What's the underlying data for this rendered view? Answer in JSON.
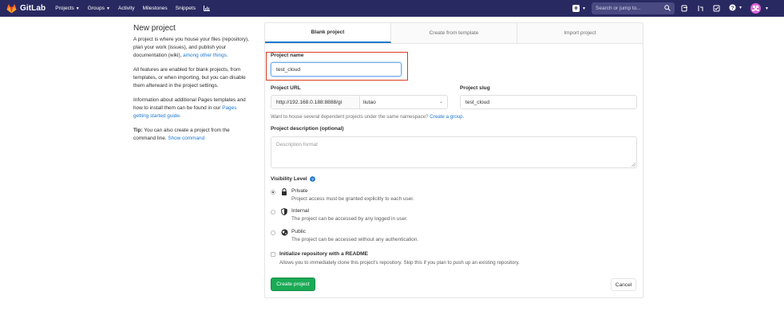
{
  "navbar": {
    "brand": "GitLab",
    "links": [
      {
        "label": "Projects",
        "dropdown": true
      },
      {
        "label": "Groups",
        "dropdown": true
      },
      {
        "label": "Activity",
        "dropdown": false
      },
      {
        "label": "Milestones",
        "dropdown": false
      },
      {
        "label": "Snippets",
        "dropdown": false
      }
    ],
    "search_placeholder": "Search or jump to...",
    "colors": {
      "bar": "#292961",
      "accent": "#fc6d26"
    }
  },
  "info": {
    "title": "New project",
    "para1_text": "A project is where you house your files (repository), plan your work (issues), and publish your documentation (wiki),",
    "para1_link": "among other things.",
    "para2": "All features are enabled for blank projects, from templates, or when importing, but you can disable them afterward in the project settings.",
    "para3_text": "Information about additional Pages templates and how to install them can be found in our",
    "para3_link": "Pages getting started guide",
    "para3_end": ".",
    "tip_label": "Tip:",
    "tip_text": "You can also create a project from the command line.",
    "tip_link": "Show command"
  },
  "tabs": {
    "blank": "Blank project",
    "template": "Create from template",
    "import": "Import project"
  },
  "form": {
    "project_name_label": "Project name",
    "project_name_value": "test_cloud",
    "project_url_label": "Project URL",
    "project_url_prefix": "http://192.168.0.188:8888/gi",
    "namespace_value": "liutao",
    "project_slug_label": "Project slug",
    "project_slug_value": "test_cloud",
    "namespace_help": "Want to house several dependent projects under the same namespace?",
    "namespace_help_link": "Create a group.",
    "description_label": "Project description (optional)",
    "description_placeholder": "Description format",
    "visibility_label": "Visibility Level",
    "visibility": [
      {
        "title": "Private",
        "desc": "Project access must be granted explicitly to each user.",
        "icon": "lock-icon",
        "checked": true
      },
      {
        "title": "Internal",
        "desc": "The project can be accessed by any logged in user.",
        "icon": "shield-icon",
        "checked": false
      },
      {
        "title": "Public",
        "desc": "The project can be accessed without any authentication.",
        "icon": "globe-icon",
        "checked": false
      }
    ],
    "readme_label": "Initialize repository with a README",
    "readme_desc": "Allows you to immediately clone this project's repository. Skip this if you plan to push up an existing repository.",
    "create_button": "Create project",
    "cancel_button": "Cancel"
  }
}
